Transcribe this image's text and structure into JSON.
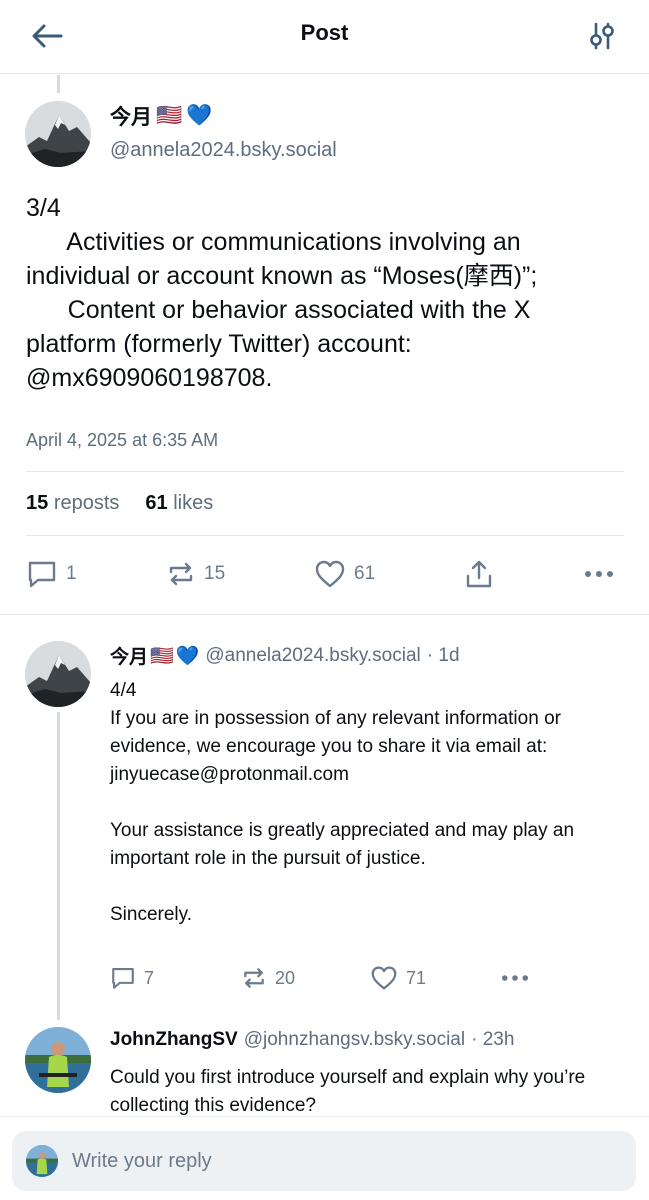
{
  "header": {
    "title": "Post"
  },
  "main_post": {
    "author_name": "今月",
    "flag": "🇺🇸",
    "heart": "💙",
    "handle": "@annela2024.bsky.social",
    "text_lines": [
      "3/4",
      "      Activities or communications involving an",
      "individual or account known as “Moses(摩西)”;",
      "      Content or behavior associated with the X",
      "platform (formerly Twitter) account:",
      "@mx6909060198708."
    ],
    "timestamp": "April 4, 2025 at 6:35 AM",
    "reposts_count": "15",
    "reposts_label": "reposts",
    "likes_count": "61",
    "likes_label": "likes",
    "actions": {
      "reply_count": "1",
      "repost_count": "15",
      "like_count": "61"
    }
  },
  "reply_1": {
    "author_name": "今月",
    "flag": "🇺🇸",
    "heart": "💙",
    "handle": "@annela2024.bsky.social",
    "time": "· 1d",
    "paragraphs": [
      "4/4",
      "If you are in possession of any relevant information or evidence, we encourage you to share it via email at:"
    ],
    "email": "jinyuecase@protonmail.com",
    "paragraph_2": "Your assistance is greatly appreciated and may play an important role in the pursuit of justice.",
    "closing": "Sincerely.",
    "actions": {
      "reply_count": "7",
      "repost_count": "20",
      "like_count": "71"
    }
  },
  "reply_2": {
    "author_name": "JohnZhangSV",
    "handle": "@johnzhangsv.bsky.social",
    "time": "· 23h",
    "text": "Could you first introduce yourself and explain why you’re collecting this evidence?"
  },
  "composer": {
    "placeholder": "Write your reply"
  },
  "colors": {
    "text": "#0b0f14",
    "muted": "#5d6d7e",
    "icon": "#6b7b8c",
    "accent": "#3a5a7a",
    "highlight": "#f6f548"
  }
}
